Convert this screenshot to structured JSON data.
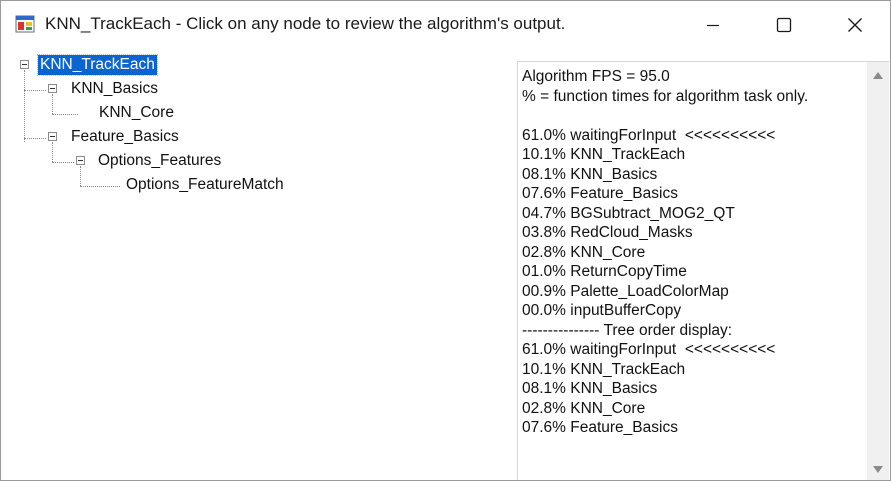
{
  "window": {
    "title": "KNN_TrackEach - Click on any node to review the algorithm's output.",
    "icon": "app-icon",
    "controls": {
      "minimize": "minimize-icon",
      "maximize": "maximize-icon",
      "close": "close-icon"
    }
  },
  "tree": {
    "nodes": [
      {
        "label": "KNN_TrackEach",
        "selected": true
      },
      {
        "label": "KNN_Basics"
      },
      {
        "label": "KNN_Core"
      },
      {
        "label": "Feature_Basics"
      },
      {
        "label": "Options_Features"
      },
      {
        "label": "Options_FeatureMatch"
      }
    ]
  },
  "output": {
    "lines": [
      "Algorithm FPS = 95.0",
      "% = function times for algorithm task only.",
      "",
      "61.0% waitingForInput  <<<<<<<<<<",
      "10.1% KNN_TrackEach",
      "08.1% KNN_Basics",
      "07.6% Feature_Basics",
      "04.7% BGSubtract_MOG2_QT",
      "03.8% RedCloud_Masks",
      "02.8% KNN_Core",
      "01.0% ReturnCopyTime",
      "00.9% Palette_LoadColorMap",
      "00.0% inputBufferCopy",
      "--------------- Tree order display:",
      "61.0% waitingForInput  <<<<<<<<<<",
      "10.1% KNN_TrackEach",
      "08.1% KNN_Basics",
      "02.8% KNN_Core",
      "07.6% Feature_Basics"
    ]
  },
  "colors": {
    "selection": "#0a64d2",
    "selection_text": "#ffffff",
    "text": "#111111"
  }
}
